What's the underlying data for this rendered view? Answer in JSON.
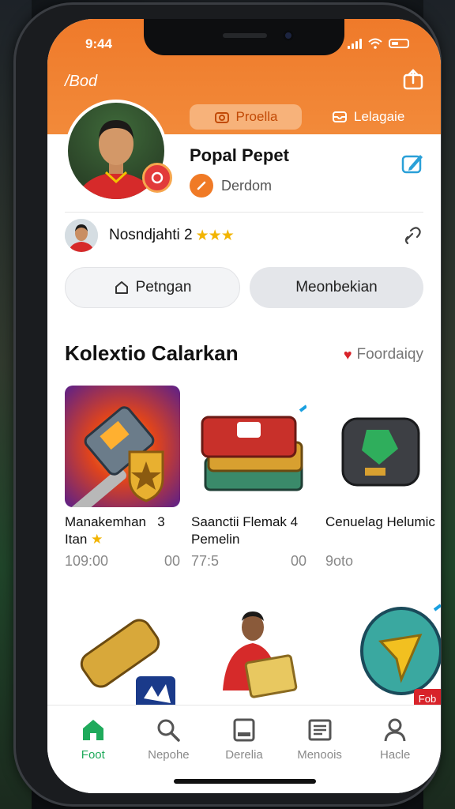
{
  "status_bar": {
    "time": "9:44"
  },
  "header": {
    "brand": "/Bod",
    "tab_active": "Proella",
    "tab_inactive": "Lelagaie"
  },
  "profile": {
    "name": "Popal Pepet",
    "role": "Derdom"
  },
  "friend": {
    "text": "Nosndjahti 2",
    "stars": "★★★"
  },
  "buttons": {
    "left_label": "Petngan",
    "right_label": "Meonbekian"
  },
  "collection": {
    "title": "Kolextio Calarkan",
    "link_label": "Foordaiqy",
    "items": [
      {
        "title_line1": "Manakemhan",
        "title_suffix": "3",
        "title_line2": "Itan",
        "price": "109:00",
        "count": "00"
      },
      {
        "title_line1": "Saanctii Flemak",
        "title_suffix": "4",
        "title_line2": "Pemelin",
        "price": "77:5",
        "count": "00"
      },
      {
        "title_line1": "Cenuelag Helumic",
        "title_suffix": "",
        "title_line2": "",
        "price": "9oto",
        "count": ""
      }
    ],
    "row2_tag": "Fob"
  },
  "bottom_nav": [
    {
      "label": "Foot",
      "icon": "home-icon",
      "active": true
    },
    {
      "label": "Nepohe",
      "icon": "search-icon",
      "active": false
    },
    {
      "label": "Derelia",
      "icon": "tablet-icon",
      "active": false
    },
    {
      "label": "Menoois",
      "icon": "news-icon",
      "active": false
    },
    {
      "label": "Hacle",
      "icon": "profile-icon",
      "active": false
    }
  ],
  "colors": {
    "header_orange": "#ef7a2a",
    "active_green": "#1faa5b",
    "star_gold": "#f2b400"
  }
}
